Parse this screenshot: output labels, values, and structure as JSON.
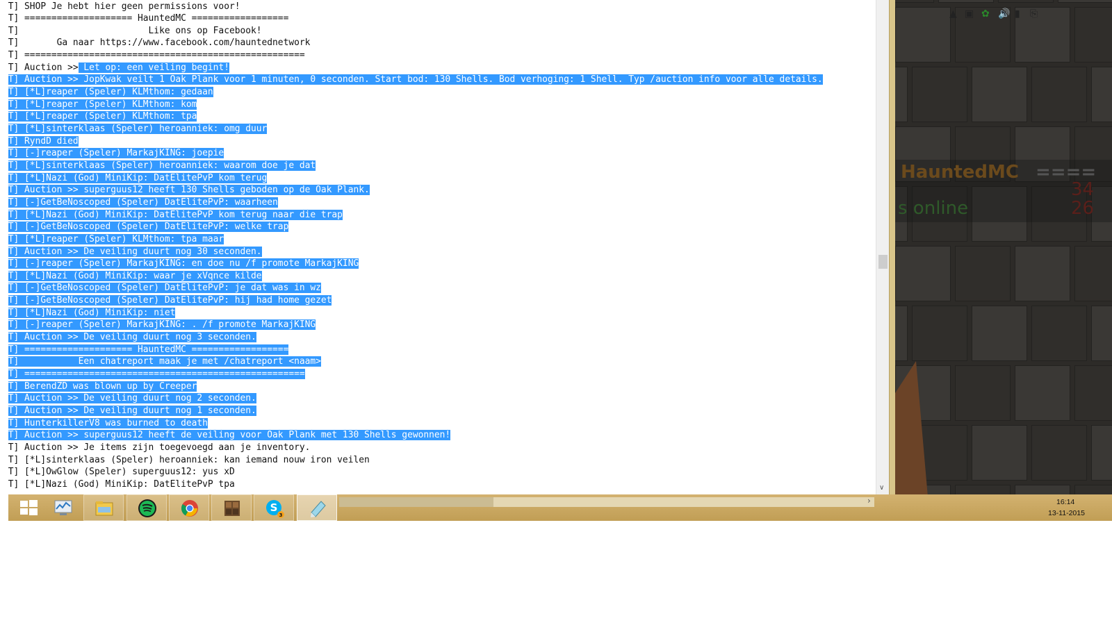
{
  "console": {
    "lines": [
      {
        "prefix": ".T] ",
        "text": "SHOP Je hebt hier geen permissions voor!",
        "sel": "none"
      },
      {
        "prefix": ".T] ",
        "text": "==================== HauntedMC ==================",
        "sel": "none"
      },
      {
        "prefix": ".T] ",
        "text": "                       Like ons op Facebook!",
        "sel": "none"
      },
      {
        "prefix": ".T] ",
        "text": "      Ga naar https://www.facebook.com/hauntednetwork",
        "sel": "none"
      },
      {
        "prefix": ".T] ",
        "text": "====================================================",
        "sel": "none"
      },
      {
        "prefix": ".T] ",
        "pre": "Auction >>",
        "text": " Let op: een veiling begint!",
        "sel": "partial"
      },
      {
        "prefix": ".T] ",
        "text": "Auction >> JopKwak veilt 1 Oak Plank voor 1 minuten, 0 seconden. Start bod: 130 Shells. Bod verhoging: 1 Shell. Typ /auction info voor alle details.",
        "sel": "full"
      },
      {
        "prefix": ".T] ",
        "text": "[*L]reaper (Speler) KLMthom: gedaan",
        "sel": "full"
      },
      {
        "prefix": ".T] ",
        "text": "[*L]reaper (Speler) KLMthom: kom",
        "sel": "full"
      },
      {
        "prefix": ".T] ",
        "text": "[*L]reaper (Speler) KLMthom: tpa",
        "sel": "full"
      },
      {
        "prefix": ".T] ",
        "text": "[*L]sinterklaas (Speler) heroanniek: omg duur",
        "sel": "full"
      },
      {
        "prefix": ".T] ",
        "text": "RyndD died",
        "sel": "full"
      },
      {
        "prefix": ".T] ",
        "text": "[-]reaper (Speler) MarkajKING: joepie",
        "sel": "full"
      },
      {
        "prefix": ".T] ",
        "text": "[*L]sinterklaas (Speler) heroanniek: waarom doe je dat",
        "sel": "full"
      },
      {
        "prefix": ".T] ",
        "text": "[*L]Nazi (God) MiniKip: DatElitePvP kom terug",
        "sel": "full"
      },
      {
        "prefix": ".T] ",
        "text": "Auction >> superguus12 heeft 130 Shells geboden op de Oak Plank.",
        "sel": "full"
      },
      {
        "prefix": ".T] ",
        "text": "[-]GetBeNoscoped (Speler) DatElitePvP: waarheen",
        "sel": "full"
      },
      {
        "prefix": ".T] ",
        "text": "[*L]Nazi (God) MiniKip: DatElitePvP kom terug naar die trap",
        "sel": "full"
      },
      {
        "prefix": ".T] ",
        "text": "[-]GetBeNoscoped (Speler) DatElitePvP: welke trap",
        "sel": "full"
      },
      {
        "prefix": ".T] ",
        "text": "[*L]reaper (Speler) KLMthom: tpa maar",
        "sel": "full"
      },
      {
        "prefix": ".T] ",
        "text": "Auction >> De veiling duurt nog 30 seconden.",
        "sel": "full"
      },
      {
        "prefix": ".T] ",
        "text": "[-]reaper (Speler) MarkajKING: en doe nu /f promote MarkajKING",
        "sel": "full"
      },
      {
        "prefix": ".T] ",
        "text": "[*L]Nazi (God) MiniKip: waar je xVqnce kilde",
        "sel": "full"
      },
      {
        "prefix": ".T] ",
        "text": "[-]GetBeNoscoped (Speler) DatElitePvP: je dat was in wz",
        "sel": "full"
      },
      {
        "prefix": ".T] ",
        "text": "[-]GetBeNoscoped (Speler) DatElitePvP: hij had home gezet",
        "sel": "full"
      },
      {
        "prefix": ".T] ",
        "text": "[*L]Nazi (God) MiniKip: niet",
        "sel": "full"
      },
      {
        "prefix": ".T] ",
        "text": "[-]reaper (Speler) MarkajKING: . /f promote MarkajKING",
        "sel": "full"
      },
      {
        "prefix": ".T] ",
        "text": "Auction >> De veiling duurt nog 3 seconden.",
        "sel": "full"
      },
      {
        "prefix": ".T] ",
        "text": "==================== HauntedMC ==================",
        "sel": "full"
      },
      {
        "prefix": ".T] ",
        "text": "          Een chatreport maak je met /chatreport <naam>",
        "sel": "full"
      },
      {
        "prefix": ".T] ",
        "text": "====================================================",
        "sel": "full"
      },
      {
        "prefix": ".T] ",
        "text": "BerendZD was blown up by Creeper",
        "sel": "full"
      },
      {
        "prefix": ".T] ",
        "text": "Auction >> De veiling duurt nog 2 seconden.",
        "sel": "full"
      },
      {
        "prefix": ".T] ",
        "text": "Auction >> De veiling duurt nog 1 seconden.",
        "sel": "full"
      },
      {
        "prefix": ".T] ",
        "text": "HunterkillerV8 was burned to death",
        "sel": "full"
      },
      {
        "prefix": ".T] ",
        "text": "Auction >> superguus12 heeft de veiling voor Oak Plank met 130 Shells gewonnen!",
        "sel": "full"
      },
      {
        "prefix": ".T] ",
        "text": "Auction >> Je items zijn toegevoegd aan je inventory.",
        "sel": "none"
      },
      {
        "prefix": ".T] ",
        "text": "[*L]sinterklaas (Speler) heroanniek: kan iemand nouw iron veilen",
        "sel": "none"
      },
      {
        "prefix": ".T] ",
        "text": "[*L]OwGlow (Speler) superguus12: yus xD",
        "sel": "none"
      },
      {
        "prefix": ".T] ",
        "text": "[*L]Nazi (God) MiniKip: DatElitePvP tpa",
        "sel": "none"
      }
    ]
  },
  "game": {
    "server_title": "HauntedMC",
    "title_dashes": "====",
    "online_text": "s online",
    "count_1": "34",
    "count_2": "26"
  },
  "taskbar": {
    "apps": [
      {
        "name": "start-button",
        "state": "none"
      },
      {
        "name": "performance-monitor",
        "state": "none"
      },
      {
        "name": "file-explorer",
        "state": "open"
      },
      {
        "name": "spotify",
        "state": "open"
      },
      {
        "name": "chrome",
        "state": "open"
      },
      {
        "name": "minecraft",
        "state": "open"
      },
      {
        "name": "skype",
        "state": "open",
        "badge": "3"
      },
      {
        "name": "notepad",
        "state": "active"
      }
    ],
    "clock_time": "16:14",
    "clock_date": "13-11-2015",
    "colors": {
      "taskbar": "#c9a85c",
      "selection": "#3399ff"
    }
  }
}
